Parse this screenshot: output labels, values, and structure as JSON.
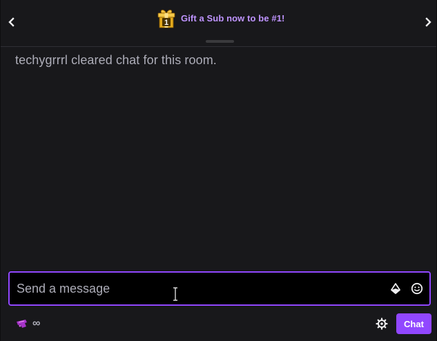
{
  "header": {
    "prev_icon": "chevron-left-icon",
    "next_icon": "chevron-right-icon",
    "promo": {
      "icon": "gift-icon",
      "badge_number": "1",
      "text": "Gift a Sub now to be #1!"
    }
  },
  "messages": [
    {
      "text": "techygrrrl cleared chat for this room."
    }
  ],
  "input": {
    "placeholder": "Send a message",
    "value": "",
    "bits_icon": "bits-icon",
    "emote_icon": "smiley-icon"
  },
  "bottom": {
    "points_icon": "channel-points-icon",
    "points_value": "∞",
    "settings_icon": "gear-icon",
    "chat_button_label": "Chat"
  },
  "colors": {
    "background": "#18181b",
    "accent": "#9147ff",
    "promo_text": "#bf94ff",
    "muted_text": "#adadb8",
    "input_bg": "#000000"
  }
}
